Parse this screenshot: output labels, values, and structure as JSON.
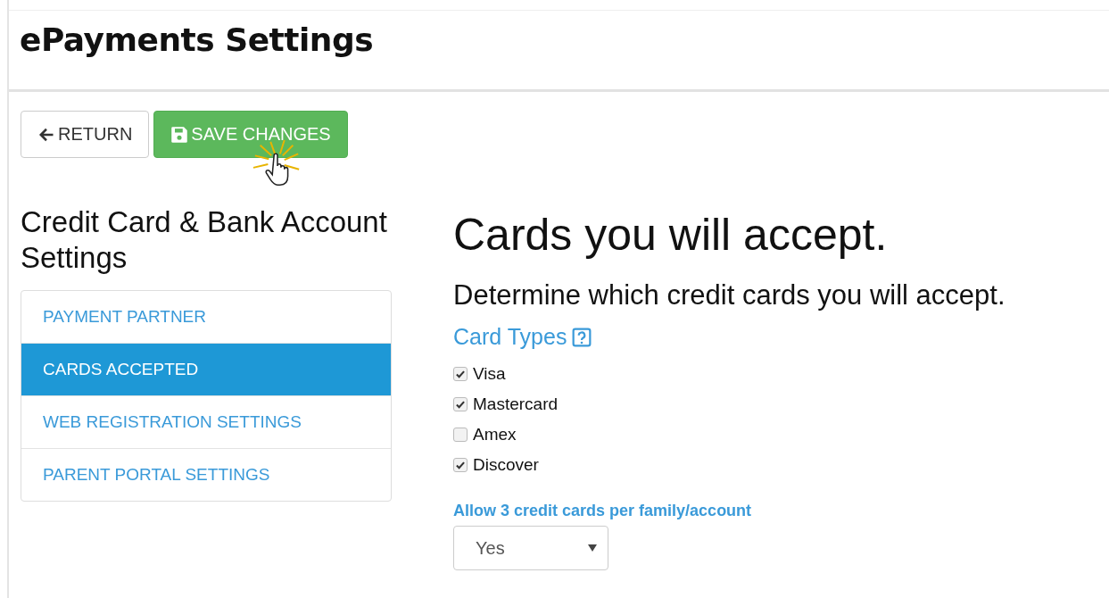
{
  "page": {
    "title": "ePayments Settings"
  },
  "buttons": [
    {
      "kind": "return",
      "label": "RETURN"
    },
    {
      "kind": "save",
      "label": "SAVE CHANGES"
    }
  ],
  "sidebar": {
    "title": "Credit Card & Bank Account Settings",
    "items": [
      {
        "label": "PAYMENT PARTNER",
        "selected": false
      },
      {
        "label": "CARDS ACCEPTED",
        "selected": true
      },
      {
        "label": "WEB REGISTRATION SETTINGS",
        "selected": false
      },
      {
        "label": "PARENT PORTAL SETTINGS",
        "selected": false
      }
    ]
  },
  "content": {
    "heading": "Cards you will accept.",
    "subheading": "Determine which credit cards you will accept.",
    "section_title": "Card Types",
    "card_types": [
      {
        "label": "Visa",
        "checked": true
      },
      {
        "label": "Mastercard",
        "checked": true
      },
      {
        "label": "Amex",
        "checked": false
      },
      {
        "label": "Discover",
        "checked": true
      }
    ],
    "allow_label": "Allow 3 credit cards per family/account",
    "allow_value": "Yes"
  }
}
